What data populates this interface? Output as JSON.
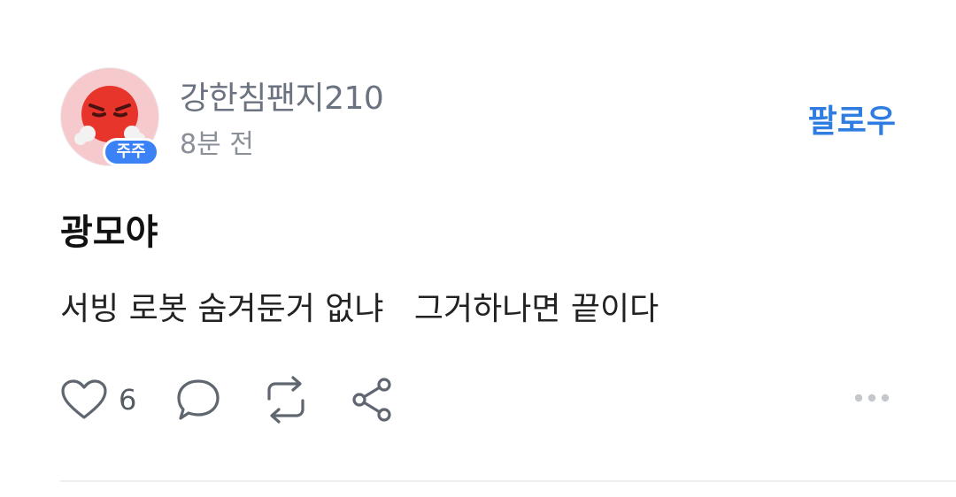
{
  "author": {
    "username": "강한침팬지210",
    "badge": "주주",
    "avatar_icon": "angry-face-icon"
  },
  "post": {
    "time": "8분 전",
    "follow_label": "팔로우",
    "title": "광모야",
    "body": "서빙 로봇 숨겨둔거 없냐   그거하나면 끝이다"
  },
  "actions": {
    "like_count": "6",
    "icons": [
      "heart-icon",
      "comment-icon",
      "repost-icon",
      "share-icon",
      "more-icon"
    ]
  },
  "colors": {
    "accent": "#2f7de1",
    "badge": "#3b82f6",
    "avatar_bg": "#f6c9cc"
  }
}
